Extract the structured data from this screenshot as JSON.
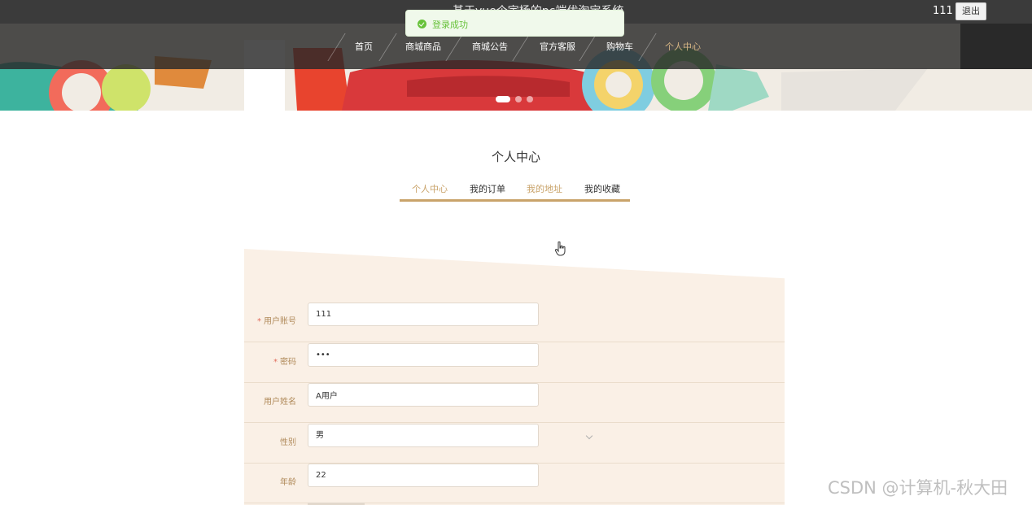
{
  "header": {
    "site_title": "基于vue个宇杨的pc端优淘宝系统",
    "username": "111",
    "logout_label": "退出"
  },
  "toast": {
    "message": "登录成功"
  },
  "nav": {
    "items": [
      {
        "label": "首页"
      },
      {
        "label": "商城商品"
      },
      {
        "label": "商城公告"
      },
      {
        "label": "官方客服"
      },
      {
        "label": "购物车"
      },
      {
        "label": "个人中心"
      }
    ],
    "active_index": 5
  },
  "carousel": {
    "slide_count": 3,
    "active_index": 0
  },
  "page": {
    "title": "个人中心"
  },
  "tabs": [
    {
      "label": "个人中心"
    },
    {
      "label": "我的订单"
    },
    {
      "label": "我的地址"
    },
    {
      "label": "我的收藏"
    }
  ],
  "form": {
    "fields": [
      {
        "label": "用户账号",
        "required": true,
        "value": "111"
      },
      {
        "label": "密码",
        "required": true,
        "value": "•••"
      },
      {
        "label": "用户姓名",
        "required": false,
        "value": "A用户"
      },
      {
        "label": "性别",
        "required": false,
        "value": "男"
      },
      {
        "label": "年龄",
        "required": false,
        "value": "22"
      }
    ]
  },
  "watermark": "CSDN @计算机-秋大田",
  "colors": {
    "accent": "#c9a36a",
    "panel_bg": "#faf0e6",
    "success": "#67c23a",
    "topbar": "#3b3b3b"
  }
}
